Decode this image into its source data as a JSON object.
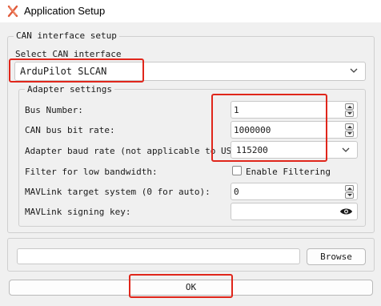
{
  "window": {
    "title": "Application Setup",
    "icon": "x-app-icon"
  },
  "can_group": {
    "legend": "CAN interface setup",
    "select_label": "Select CAN interface",
    "interface_value": "ArduPilot SLCAN"
  },
  "adapter": {
    "legend": "Adapter settings",
    "bus_number_label": "Bus Number:",
    "bus_number_value": "1",
    "bitrate_label": "CAN bus bit rate:",
    "bitrate_value": "1000000",
    "baud_label": "Adapter baud rate (not applicable to USB):",
    "baud_value": "115200",
    "filter_label": "Filter for low bandwidth:",
    "filter_checkbox_label": "Enable Filtering",
    "filter_checked": false,
    "mav_target_label": "MAVLink target system (0 for auto):",
    "mav_target_value": "0",
    "signing_label": "MAVLink signing key:",
    "signing_value": ""
  },
  "file": {
    "path_value": "",
    "browse_label": "Browse"
  },
  "ok_label": "OK",
  "colors": {
    "highlight": "#e0261b",
    "background": "#f0f0f0"
  }
}
